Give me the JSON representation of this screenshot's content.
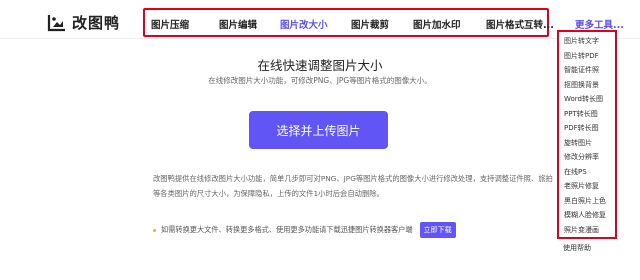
{
  "brand": {
    "name": "改图鸭"
  },
  "nav": {
    "items": [
      "图片压缩",
      "图片编辑",
      "图片改大小",
      "图片裁剪",
      "图片加水印",
      "图片格式互转..."
    ],
    "more": "更多工具..."
  },
  "dropdown": {
    "items": [
      "图片转文字",
      "图片转PDF",
      "智能证件照",
      "抠图换背景",
      "Word转长图",
      "PPT转长图",
      "PDF转长图",
      "旋转图片",
      "修改分辨率",
      "在线PS",
      "老照片修复",
      "黑白照片上色",
      "模糊人脸修复",
      "照片变漫画"
    ],
    "help": "使用帮助"
  },
  "main": {
    "title": "在线快速调整图片大小",
    "subtitle": "在线修改图片大小功能，可修改PNG、JPG等图片格式的图像大小。",
    "upload_label": "选择并上传图片",
    "desc": "改图鸭提供在线修改图片大小功能，简单几步即可对PNG、JPG等图片格式的图像大小进行修改处理，支持调整证件照、旅拍等各类图片的尺寸大小，为保障隐私，上传的文件1小时后会自动删除。",
    "notice": "如需转换更大文件、转换更多格式、使用更多功能请下载迅捷图片转换器客户端",
    "download_label": "立即下载"
  },
  "colors": {
    "accent": "#6155f5",
    "highlight": "#e0001b"
  }
}
